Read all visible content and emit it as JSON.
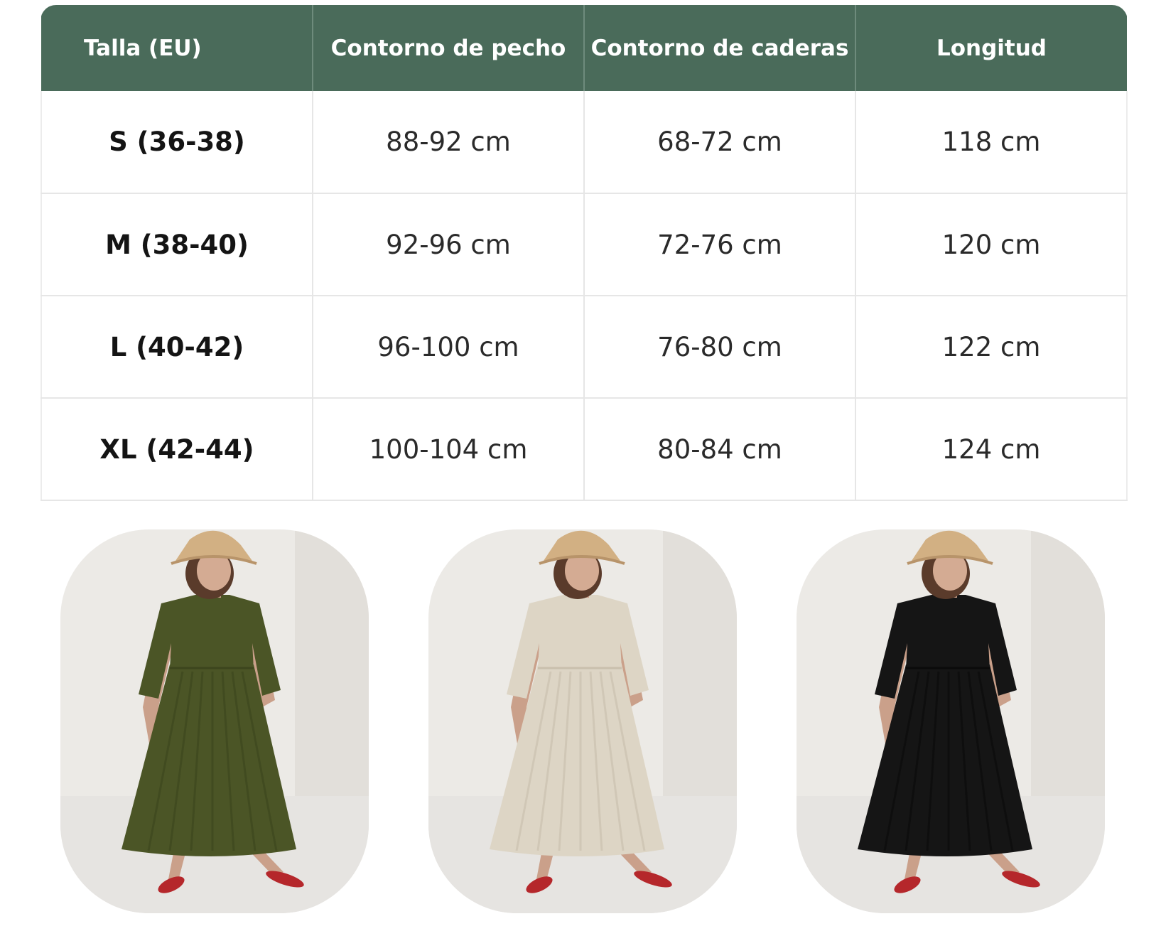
{
  "size_table": {
    "headers": [
      "Talla (EU)",
      "Contorno de pecho",
      "Contorno de caderas",
      "Longitud"
    ],
    "rows": [
      [
        "S (36-38)",
        "88-92 cm",
        "68-72 cm",
        "118 cm"
      ],
      [
        "M (38-40)",
        "92-96 cm",
        "72-76 cm",
        "120 cm"
      ],
      [
        "L (40-42)",
        "96-100 cm",
        "76-80 cm",
        "122 cm"
      ],
      [
        "XL (42-44)",
        "100-104 cm",
        "80-84 cm",
        "124 cm"
      ]
    ],
    "header_color": "#4a6b5a"
  },
  "photos": [
    {
      "dress_color": "#4b5526",
      "dress_shade": "#3c451d",
      "hat_color": "#d2b083",
      "shoe_color": "#b5272b"
    },
    {
      "dress_color": "#ddd5c5",
      "dress_shade": "#c9bfad",
      "hat_color": "#d2b083",
      "shoe_color": "#b5272b"
    },
    {
      "dress_color": "#151515",
      "dress_shade": "#0a0a0a",
      "hat_color": "#d2b083",
      "shoe_color": "#b5272b"
    }
  ]
}
